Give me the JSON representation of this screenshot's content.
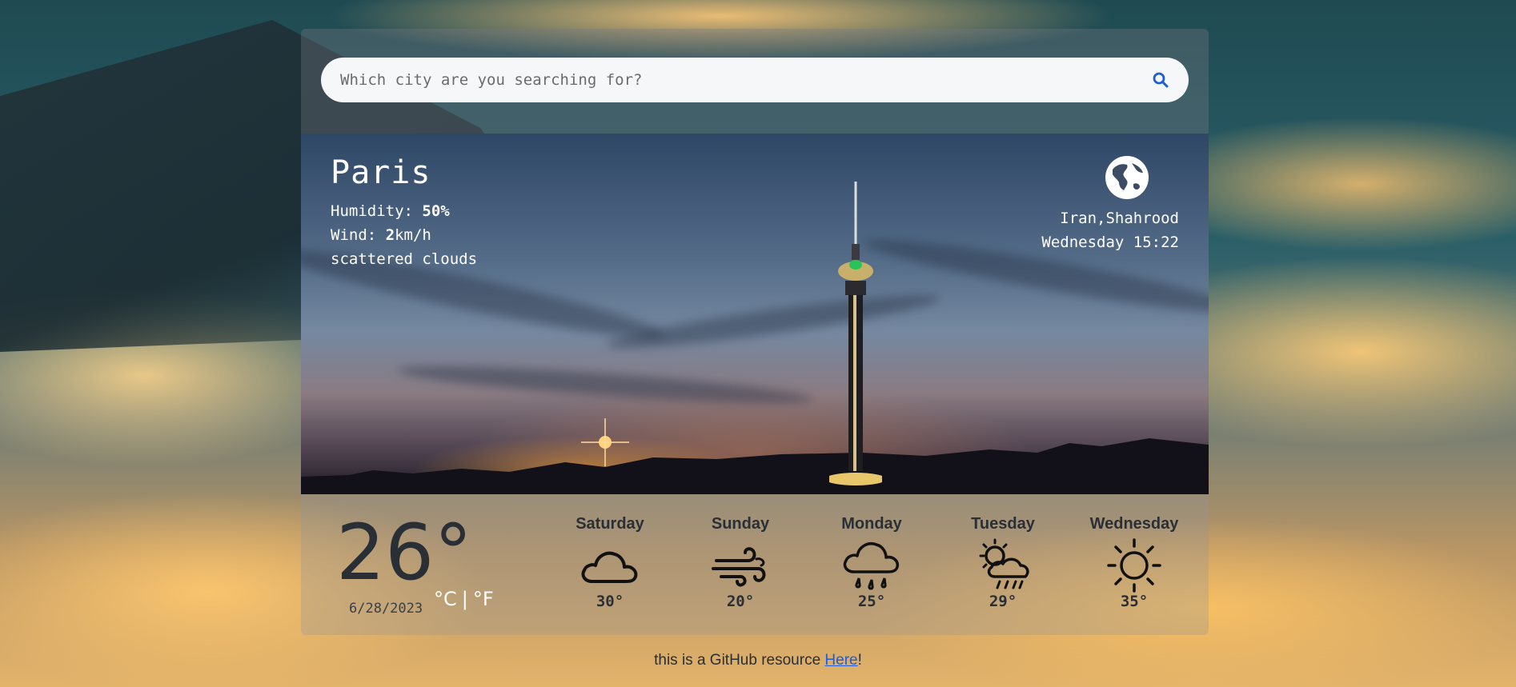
{
  "search": {
    "placeholder": "Which city are you searching for?"
  },
  "current": {
    "city": "Paris",
    "humidity_label": "Humidity:",
    "humidity_value": "50%",
    "wind_label": "Wind:",
    "wind_value": "2",
    "wind_unit": "km/h",
    "description": "scattered clouds",
    "location": "Iran,Shahrood",
    "datetime": "Wednesday 15:22",
    "temperature": "26°",
    "unit_c": "°C",
    "unit_separator": "|",
    "unit_f": "°F",
    "date": "6/28/2023"
  },
  "forecast": [
    {
      "day": "Saturday",
      "temp": "30°",
      "icon": "cloud-icon"
    },
    {
      "day": "Sunday",
      "temp": "20°",
      "icon": "wind-icon"
    },
    {
      "day": "Monday",
      "temp": "25°",
      "icon": "rain-cloud-icon"
    },
    {
      "day": "Tuesday",
      "temp": "29°",
      "icon": "sun-cloud-rain-icon"
    },
    {
      "day": "Wednesday",
      "temp": "35°",
      "icon": "sun-icon"
    }
  ],
  "footer": {
    "text": "this is a GitHub resource ",
    "link": "Here",
    "suffix": "!"
  },
  "colors": {
    "accent": "#1e5cd8",
    "text_dark": "#2a2f35"
  }
}
